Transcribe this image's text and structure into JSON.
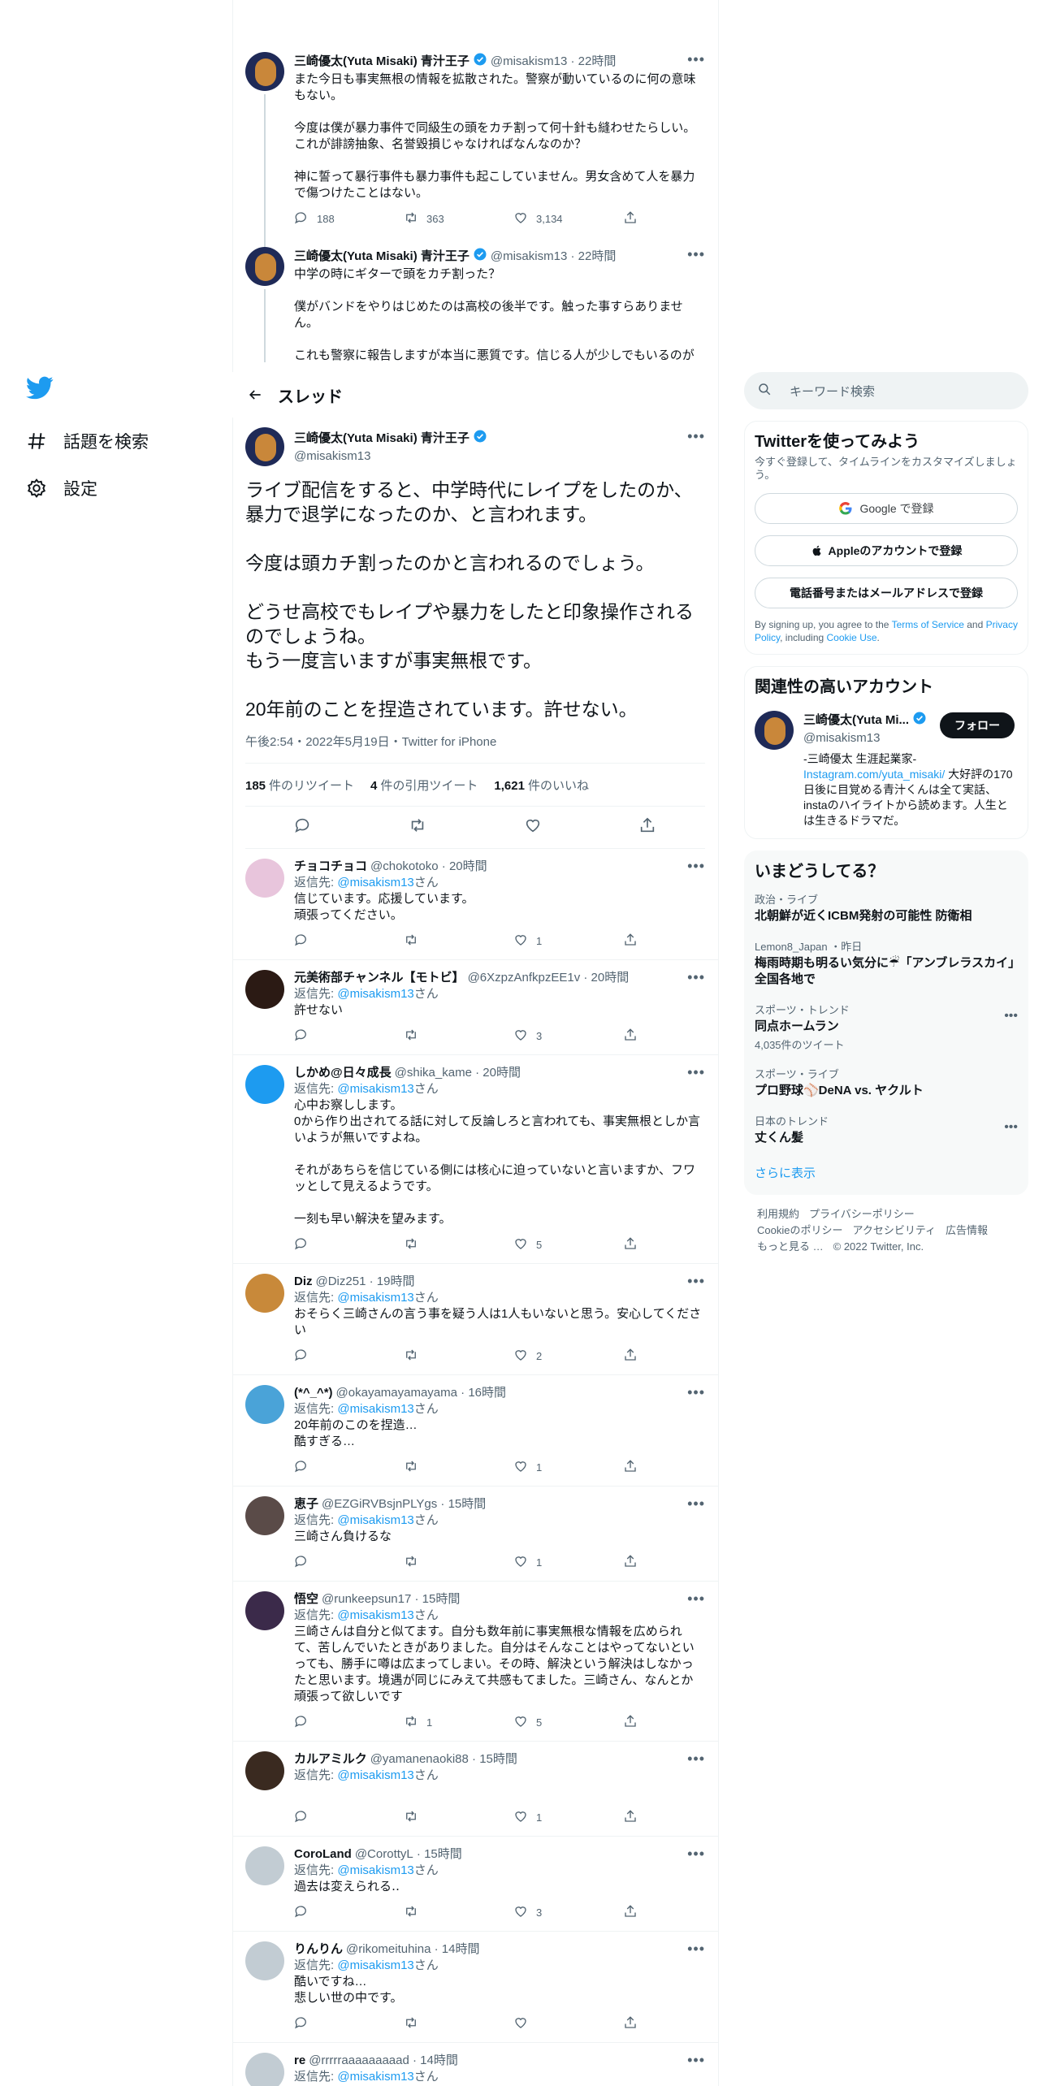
{
  "nav": {
    "items": [
      {
        "label": "話題を検索",
        "icon": "hashtag-icon"
      },
      {
        "label": "設定",
        "icon": "gear-icon"
      }
    ]
  },
  "header": {
    "title": "スレッド"
  },
  "context_tweets": [
    {
      "name": "三崎優太(Yuta Misaki) 青汁王子",
      "handle": "@misakism13",
      "time": "22時間",
      "text": "また今日も事実無根の情報を拡散された。警察が動いているのに何の意味もない。\n\n今度は僕が暴力事件で同級生の頭をカチ割って何十針も縫わせたらしい。\nこれが誹謗抽象、名誉毀損じゃなければなんなのか？\n\n神に誓って暴行事件も暴力事件も起こしていません。男女含めて人を暴力で傷つけたことはない。",
      "replies": "188",
      "retweets": "363",
      "likes": "3,134"
    },
    {
      "name": "三崎優太(Yuta Misaki) 青汁王子",
      "handle": "@misakism13",
      "time": "22時間",
      "text": "中学の時にギターで頭をカチ割った？\n\n僕がバンドをやりはじめたのは高校の後半です。触った事すらありません。\n\nこれも警察に報告しますが本当に悪質です。信じる人が少しでもいるのが僕は悲しい。もう疲れました。"
    }
  ],
  "focal": {
    "name": "三崎優太(Yuta Misaki) 青汁王子",
    "handle": "@misakism13",
    "text": "ライブ配信をすると、中学時代にレイプをしたのか、暴力で退学になったのか、と言われます。\n\n今度は頭カチ割ったのかと言われるのでしょう。\n\nどうせ高校でもレイプや暴力をしたと印象操作されるのでしょうね。\nもう一度言いますが事実無根です。\n\n20年前のことを捏造されています。許せない。",
    "timestamp": "午後2:54・2022年5月19日・Twitter for iPhone",
    "retweets": "185",
    "retweets_label": "件のリツイート",
    "quotes": "4",
    "quotes_label": "件の引用ツイート",
    "likes": "1,621",
    "likes_label": "件のいいね"
  },
  "reply_prefix": "返信先: ",
  "reply_to": "@misakism13",
  "reply_suffix": "さん",
  "replies": [
    {
      "name": "チョコチョコ",
      "handle": "@chokotoko",
      "time": "20時間",
      "text": "信じています。応援しています。\n頑張ってください。",
      "replies": "",
      "retweets": "",
      "likes": "1",
      "avatar": "#e8c5dc"
    },
    {
      "name": "元美術部チャンネル【モトビ】",
      "handle": "@6XzpzAnfkpzEE1v",
      "time": "20時間",
      "text": "許せない",
      "replies": "",
      "retweets": "",
      "likes": "3",
      "avatar": "#2b1a14"
    },
    {
      "name": "しかめ@日々成長",
      "handle": "@shika_kame",
      "time": "20時間",
      "text": "心中お察しします。\n0から作り出されてる話に対して反論しろと言われても、事実無根としか言いようが無いですよね。\n\nそれがあちらを信じている側には核心に迫っていないと言いますか、フワッとして見えるようです。\n\n一刻も早い解決を望みます。",
      "replies": "",
      "retweets": "",
      "likes": "5",
      "avatar": "#1d9bf0"
    },
    {
      "name": "Diz",
      "handle": "@Diz251",
      "time": "19時間",
      "text": "おそらく三崎さんの言う事を疑う人は1人もいないと思う。安心してください",
      "replies": "",
      "retweets": "",
      "likes": "2",
      "avatar": "#c8893a"
    },
    {
      "name": "(*^_^*)",
      "handle": "@okayamayamayama",
      "time": "16時間",
      "text": "20年前のこのを捏造…\n酷すぎる…",
      "replies": "",
      "retweets": "",
      "likes": "1",
      "avatar": "#4aa3d8"
    },
    {
      "name": "恵子",
      "handle": "@EZGiRVBsjnPLYgs",
      "time": "15時間",
      "text": "三崎さん負けるな",
      "replies": "",
      "retweets": "",
      "likes": "1",
      "avatar": "#5a4b48"
    },
    {
      "name": "悟空",
      "handle": "@runkeepsun17",
      "time": "15時間",
      "text": "三崎さんは自分と似てます。自分も数年前に事実無根な情報を広められて、苦しんでいたときがありました。自分はそんなことはやってないといっても、勝手に噂は広まってしまい。その時、解決という解決はしなかったと思います。境遇が同じにみえて共感もてました。三崎さん、なんとか頑張って欲しいです",
      "replies": "",
      "retweets": "1",
      "likes": "5",
      "avatar": "#3b2a4a"
    },
    {
      "name": "カルアミルク",
      "handle": "@yamanenaoki88",
      "time": "15時間",
      "text": "",
      "replies": "",
      "retweets": "",
      "likes": "1",
      "avatar": "#3a2a20"
    },
    {
      "name": "CoroLand",
      "handle": "@CorottyL",
      "time": "15時間",
      "text": "過去は変えられる‥",
      "replies": "",
      "retweets": "",
      "likes": "3",
      "avatar": "#c2ccd3"
    },
    {
      "name": "りんりん",
      "handle": "@rikomeituhina",
      "time": "14時間",
      "text": "酷いですね…\n悲しい世の中です。",
      "replies": "",
      "retweets": "",
      "likes": "",
      "avatar": "#c2ccd3"
    },
    {
      "name": "re",
      "handle": "@rrrrraaaaaaaaad",
      "time": "14時間",
      "text": "",
      "replies": "",
      "retweets": "",
      "likes": "",
      "avatar": "#c2ccd3"
    }
  ],
  "right": {
    "search_placeholder": "キーワード検索",
    "signup": {
      "title": "Twitterを使ってみよう",
      "subtitle": "今すぐ登録して、タイムラインをカスタマイズしましょう。",
      "google": "Google で登録",
      "apple": "Appleのアカウントで登録",
      "phone": "電話番号またはメールアドレスで登録",
      "legal_1": "By signing up, you agree to the ",
      "terms": "Terms of Service",
      "legal_2": " and ",
      "privacy": "Privacy Policy",
      "legal_3": ", including ",
      "cookie": "Cookie Use",
      "legal_4": "."
    },
    "related": {
      "title": "関連性の高いアカウント",
      "name": "三崎優太(Yuta Mi...",
      "handle": "@misakism13",
      "follow": "フォロー",
      "bio_1": "-三崎優太 生涯起業家-",
      "bio_link": "Instagram.com/yuta_misaki/",
      "bio_2": " 大好評の170日後に目覚める青汁くんは全て実話、instaのハイライトから読めます。人生とは生きるドラマだ。"
    },
    "trends": {
      "title": "いまどうしてる？",
      "items": [
        {
          "meta": "政治・ライブ",
          "title": "北朝鮮が近くICBM発射の可能性 防衛相",
          "count": ""
        },
        {
          "meta": "Lemon8_Japan ・昨日",
          "title": "梅雨時期も明るい気分に☔「アンブレラスカイ」全国各地で",
          "count": ""
        },
        {
          "meta": "スポーツ・トレンド",
          "title": "同点ホームラン",
          "count": "4,035件のツイート"
        },
        {
          "meta": "スポーツ・ライブ",
          "title": "プロ野球⚾DeNA vs. ヤクルト",
          "count": ""
        },
        {
          "meta": "日本のトレンド",
          "title": "丈くん髪",
          "count": ""
        }
      ],
      "show_more": "さらに表示"
    },
    "footer": {
      "row1": [
        "利用規約",
        "プライバシーポリシー"
      ],
      "row2": [
        "Cookieのポリシー",
        "アクセシビリティ",
        "広告情報"
      ],
      "row3": [
        "もっと見る …",
        "© 2022 Twitter, Inc."
      ]
    }
  },
  "colors": {
    "accent": "#1d9bf0",
    "text": "#0f1419",
    "muted": "#536471",
    "border": "#eff3f4"
  }
}
